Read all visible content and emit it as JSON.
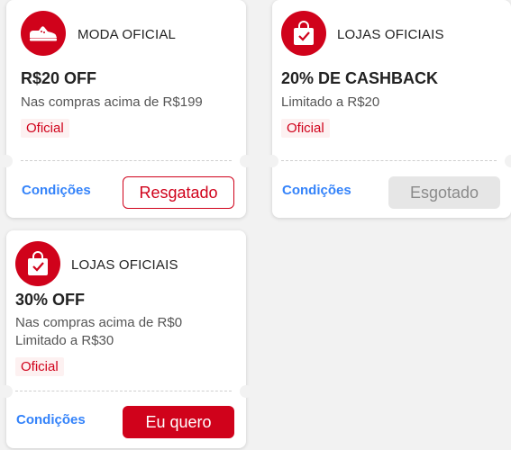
{
  "coupons": [
    {
      "store": "MODA OFICIAL",
      "icon": "sneaker-icon",
      "title": "R$20 OFF",
      "lines": [
        "Nas compras acima de R$199"
      ],
      "badge": "Oficial",
      "conditions": "Condições",
      "button": "Resgatado",
      "button_state": "redeemed"
    },
    {
      "store": "LOJAS OFICIAIS",
      "icon": "shopping-bag-check-icon",
      "title": "20% DE CASHBACK",
      "lines": [
        "Limitado a R$20"
      ],
      "badge": "Oficial",
      "conditions": "Condições",
      "button": "Esgotado",
      "button_state": "sold-out"
    },
    {
      "store": "LOJAS OFICIAIS",
      "icon": "shopping-bag-check-icon",
      "title": "30% OFF",
      "lines": [
        "Nas compras acima de R$0",
        "Limitado a R$30"
      ],
      "badge": "Oficial",
      "conditions": "Condições",
      "button": "Eu quero",
      "button_state": "available"
    }
  ],
  "colors": {
    "brand_red": "#d0021b",
    "link_blue": "#3483fa",
    "disabled_bg": "#e6e6e6"
  }
}
